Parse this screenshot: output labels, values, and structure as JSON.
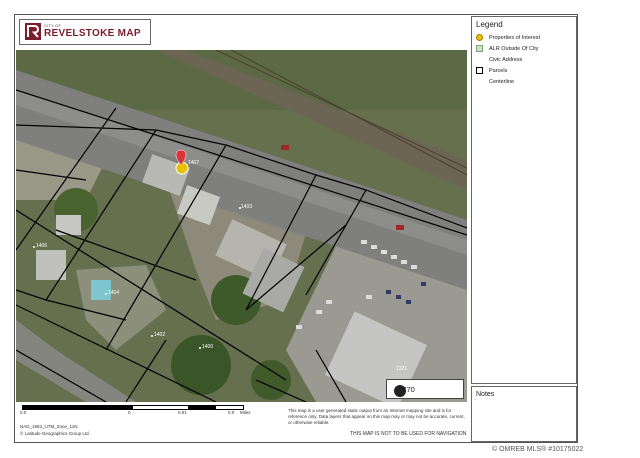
{
  "header": {
    "logo_small": "CITY OF",
    "logo_title": "REVELSTOKE MAP"
  },
  "legend": {
    "title": "Legend",
    "items": [
      {
        "label": "Properties of Interest",
        "icon": "property-marker-icon",
        "color": "#e8c200"
      },
      {
        "label": "ALR Outside Of City",
        "icon": "alr-swatch",
        "color": "#c8e6c9"
      },
      {
        "label": "Civic Address",
        "icon": "none"
      },
      {
        "label": "Parcels",
        "icon": "parcel-swatch",
        "color": "#000000"
      },
      {
        "label": "Centerline",
        "icon": "none"
      }
    ]
  },
  "notes": {
    "title": "Notes"
  },
  "map": {
    "addresses": [
      "1407",
      "1403",
      "1406",
      "1404",
      "1402",
      "1400",
      "1321"
    ],
    "scale_ratio": "1: 770"
  },
  "footer": {
    "scale_ticks": [
      "0.0",
      "0",
      "0.01",
      "0.0",
      "Miles"
    ],
    "projection": "NAD_1983_UTM_Zone_11N",
    "copyright": "© Latitude Geographics Group Ltd.",
    "disclaimer": "This map is a user generated static output from an Internet mapping site and is for reference only. Data layers that appear on this map may or may not be accurate, current, or otherwise reliable.",
    "navigation_warning": "THIS MAP IS NOT TO BE USED FOR NAVIGATION"
  },
  "watermark": "© OMREB MLS® #10175022"
}
